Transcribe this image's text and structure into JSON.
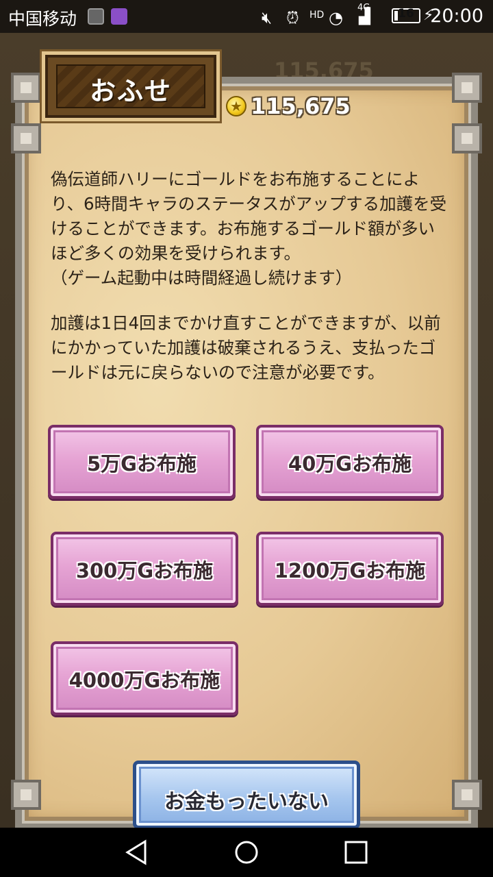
{
  "status_bar": {
    "carrier": "中国移动",
    "network": "4G",
    "hd": "HD",
    "battery_level": "16",
    "battery_fraction": 0.16,
    "time": "20:00"
  },
  "background": {
    "top_number": "115,675"
  },
  "dialog": {
    "title": "おふせ",
    "gold_amount": "115,675",
    "description_1": "偽伝道師ハリーにゴールドをお布施することにより、6時間キャラのステータスがアップする加護を受けることができます。お布施するゴールド額が多いほど多くの効果を受けられます。\n（ゲーム起動中は時間経過し続けます）",
    "description_2": "加護は1日4回までかけ直すことができますが、以前にかかっていた加護は破棄されるうえ、支払ったゴールドは元に戻らないので注意が必要です。",
    "offers": [
      {
        "label": "5万Gお布施"
      },
      {
        "label": "40万Gお布施"
      },
      {
        "label": "300万Gお布施"
      },
      {
        "label": "1200万Gお布施"
      },
      {
        "label": "4000万Gお布施"
      }
    ],
    "cancel_label": "お金もったいない"
  },
  "colors": {
    "panel_parchment": "#e6c995",
    "offer_pink": "#e6a4d4",
    "cancel_blue": "#a6c6ee",
    "title_wood": "#6a4a22"
  }
}
